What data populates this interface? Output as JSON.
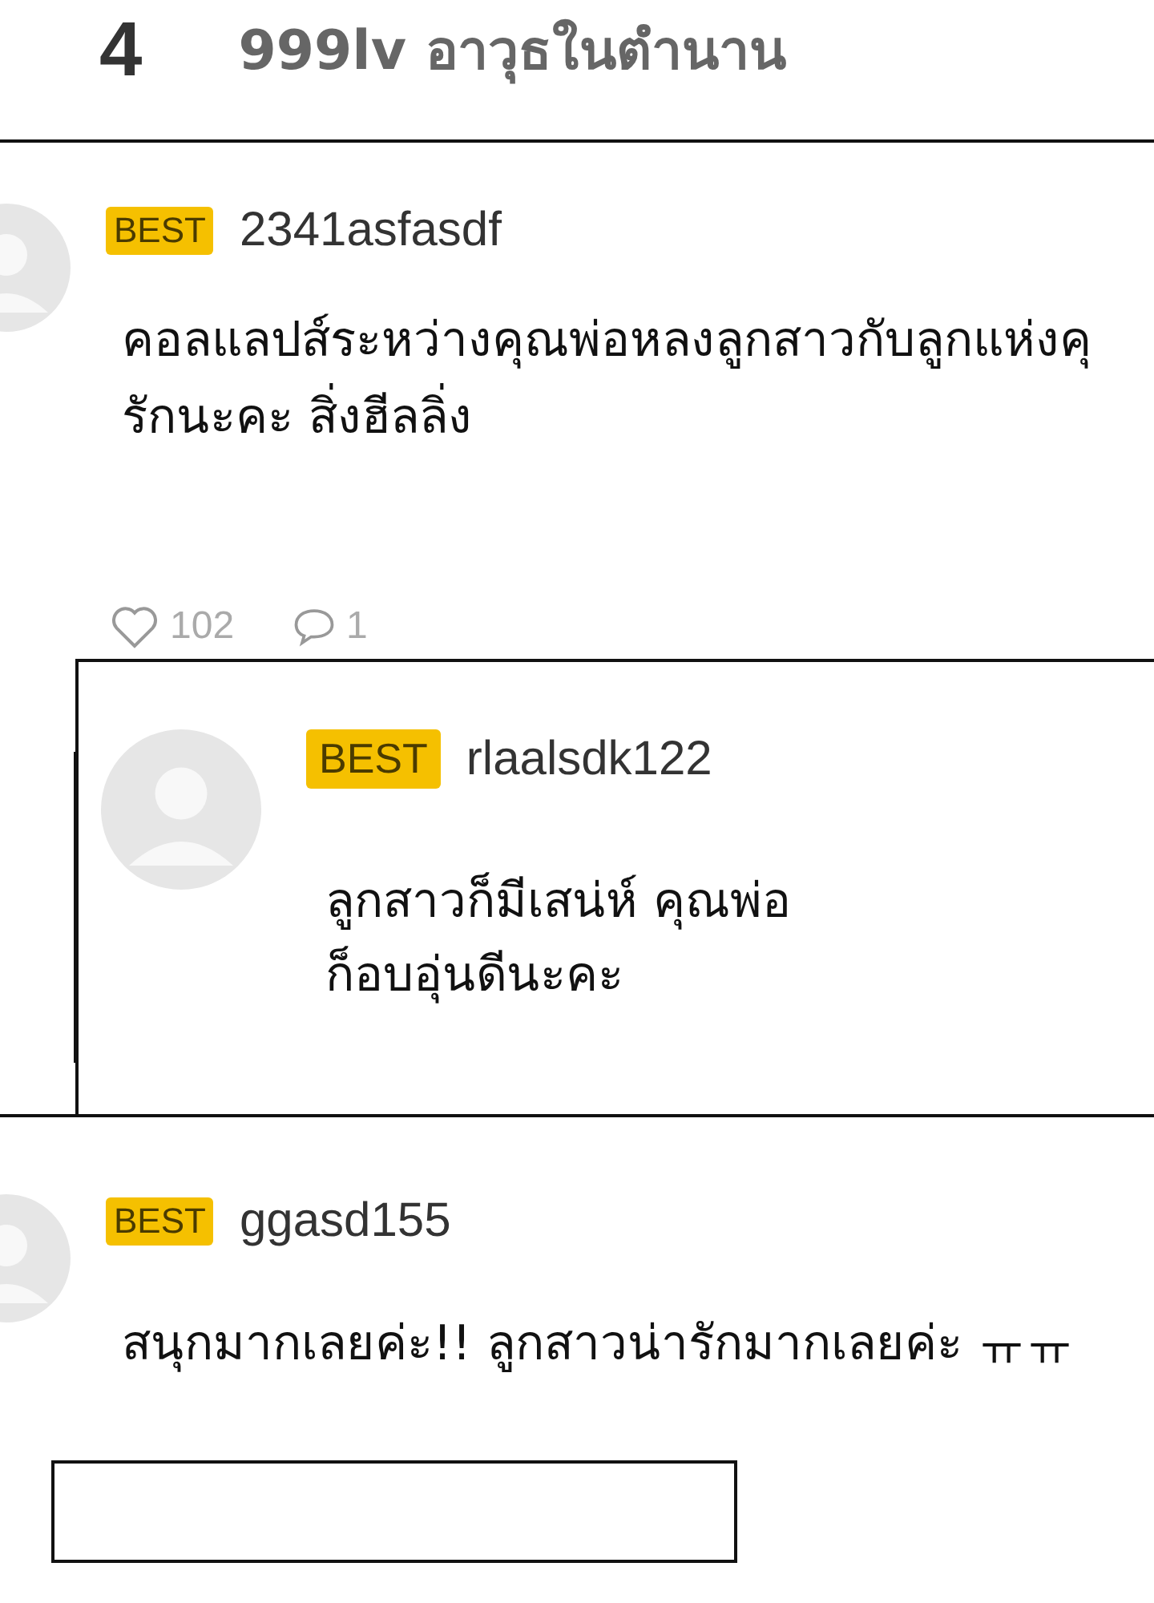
{
  "header": {
    "number": "4",
    "title": "999lv อาวุธในตำนาน"
  },
  "comments": [
    {
      "kind": "top",
      "badge": "BEST",
      "username": "2341asfasdf",
      "lines": [
        "คอลแลปส์ระหว่างคุณพ่อหลงลูกสาวกับลูกแห่งคุ",
        "รักนะคะ สิ่งฮีลลิ่ง"
      ],
      "likes": "102",
      "replies": "1"
    },
    {
      "kind": "reply",
      "badge": "BEST",
      "username": "rlaalsdk122",
      "lines": [
        "ลูกสาวก็มีเสน่ห์ คุณพ่อ",
        "ก็อบอุ่นดีนะคะ"
      ]
    },
    {
      "kind": "top",
      "badge": "BEST",
      "username": "ggasd155",
      "lines": [
        "สนุกมากเลยค่ะ!! ลูกสาวน่ารักมากเลยค่ะ ㅠㅠ"
      ]
    }
  ]
}
